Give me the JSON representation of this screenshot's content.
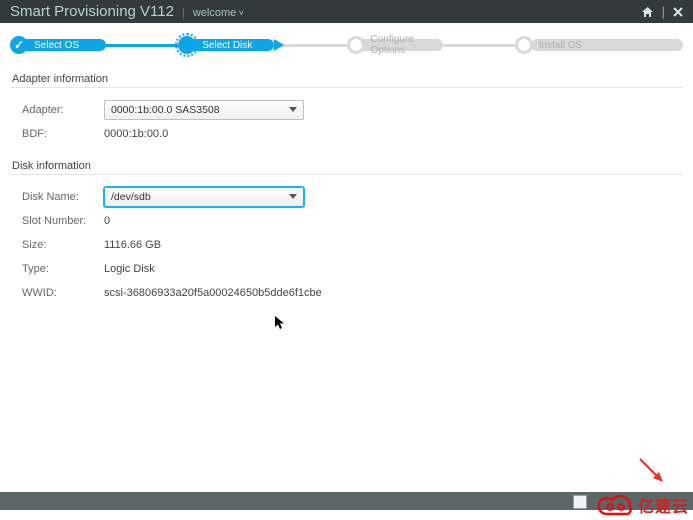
{
  "header": {
    "title": "Smart Provisioning V112",
    "welcome": "welcome"
  },
  "stepper": {
    "steps": [
      {
        "label": "Select OS"
      },
      {
        "label": "Select Disk"
      },
      {
        "label": "Configure Options"
      },
      {
        "label": "Install OS"
      }
    ]
  },
  "adapter_section": {
    "title": "Adapter information",
    "adapter_label": "Adapter:",
    "adapter_value": "0000:1b:00.0   SAS3508",
    "bdf_label": "BDF:",
    "bdf_value": "0000:1b:00.0"
  },
  "disk_section": {
    "title": "Disk information",
    "disk_name_label": "Disk Name:",
    "disk_name_value": "/dev/sdb",
    "slot_label": "Slot Number:",
    "slot_value": "0",
    "size_label": "Size:",
    "size_value": "1116.66 GB",
    "type_label": "Type:",
    "type_value": "Logic Disk",
    "wwid_label": "WWID:",
    "wwid_value": "scsi-36806933a20f5a00024650b5dde6f1cbe"
  },
  "overlay": {
    "brand": "亿速云"
  }
}
